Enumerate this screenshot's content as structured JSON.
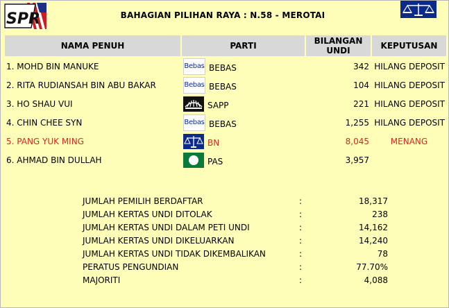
{
  "header": {
    "title": "BAHAGIAN PILIHAN RAYA : N.58 - MEROTAI",
    "logo_text": "SPR"
  },
  "columns": {
    "name": "NAMA PENUH",
    "party": "PARTI",
    "votes_line1": "BILANGAN",
    "votes_line2": "UNDI",
    "result": "KEPUTUSAN"
  },
  "candidates": [
    {
      "name": "1. MOHD BIN MANUKE",
      "party_logo": "BEBAS-LOGO",
      "party_logo_text": "Bebas",
      "party": "BEBAS",
      "votes": "342",
      "result": "HILANG DEPOSIT"
    },
    {
      "name": "2. RITA RUDIANSAH BIN ABU BAKAR",
      "party_logo": "BEBAS-LOGO",
      "party_logo_text": "Bebas",
      "party": "BEBAS",
      "votes": "104",
      "result": "HILANG DEPOSIT"
    },
    {
      "name": "3. HO SHAU VUI",
      "party_logo": "sapp-logo",
      "party": "SAPP",
      "votes": "221",
      "result": "HILANG DEPOSIT"
    },
    {
      "name": "4. CHIN CHEE SYN",
      "party_logo": "BEBAS-LOGO",
      "party_logo_text": "Bebas",
      "party": "BEBAS",
      "votes": "1,255",
      "result": "HILANG DEPOSIT"
    },
    {
      "name": "5. PANG YUK MING",
      "party_logo": "bn-scales-logo",
      "party": "BN",
      "votes": "8,045",
      "result": "MENANG",
      "winner": true
    },
    {
      "name": "6. AHMAD BIN DULLAH",
      "party_logo": "pas-logo",
      "party": "PAS",
      "votes": "3,957",
      "result": ""
    }
  ],
  "stats": [
    {
      "label": "JUMLAH PEMILIH BERDAFTAR",
      "value": "18,317"
    },
    {
      "label": "JUMLAH KERTAS UNDI DITOLAK",
      "value": "238"
    },
    {
      "label": "JUMLAH KERTAS UNDI DALAM PETI UNDI",
      "value": "14,162"
    },
    {
      "label": "JUMLAH KERTAS UNDI DIKELUARKAN",
      "value": "14,240"
    },
    {
      "label": "JUMLAH KERTAS UNDI TIDAK DIKEMBALIKAN",
      "value": "78"
    },
    {
      "label": "PERATUS PENGUNDIAN",
      "value": "77.70%"
    },
    {
      "label": "MAJORITI",
      "value": "4,088"
    }
  ],
  "stats_separator": ":",
  "colors": {
    "background": "#fefeb8",
    "header_cell": "#d8d8d8",
    "winner_text": "#e0241a",
    "bn_blue": "#0c2a8a",
    "pas_green": "#0a7a3a"
  }
}
